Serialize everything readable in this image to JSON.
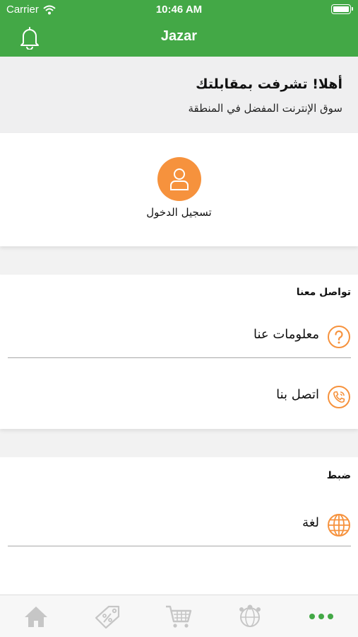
{
  "status_bar": {
    "carrier": "Carrier",
    "time": "10:46 AM"
  },
  "nav": {
    "title": "Jazar"
  },
  "welcome": {
    "heading": "أهلا! تشرفت بمقابلتك",
    "subheading": "سوق الإنترنت المفضل في المنطقة"
  },
  "login": {
    "label": "تسجيل الدخول"
  },
  "contact": {
    "title": "تواصل معنا",
    "items": [
      {
        "label": "معلومات عنا",
        "icon": "question-icon"
      },
      {
        "label": "اتصل بنا",
        "icon": "phone-icon"
      }
    ]
  },
  "settings": {
    "title": "ضبط",
    "items": [
      {
        "label": "لغة",
        "icon": "globe-icon"
      }
    ]
  },
  "tabs": [
    {
      "name": "home",
      "icon": "home-icon"
    },
    {
      "name": "offers",
      "icon": "tag-icon"
    },
    {
      "name": "cart",
      "icon": "cart-icon"
    },
    {
      "name": "world",
      "icon": "globe-pin-icon"
    },
    {
      "name": "more",
      "icon": "more-icon",
      "active": true
    }
  ],
  "colors": {
    "primary": "#43a846",
    "accent": "#f6923d",
    "inactive_tab": "#c6c6c6"
  }
}
